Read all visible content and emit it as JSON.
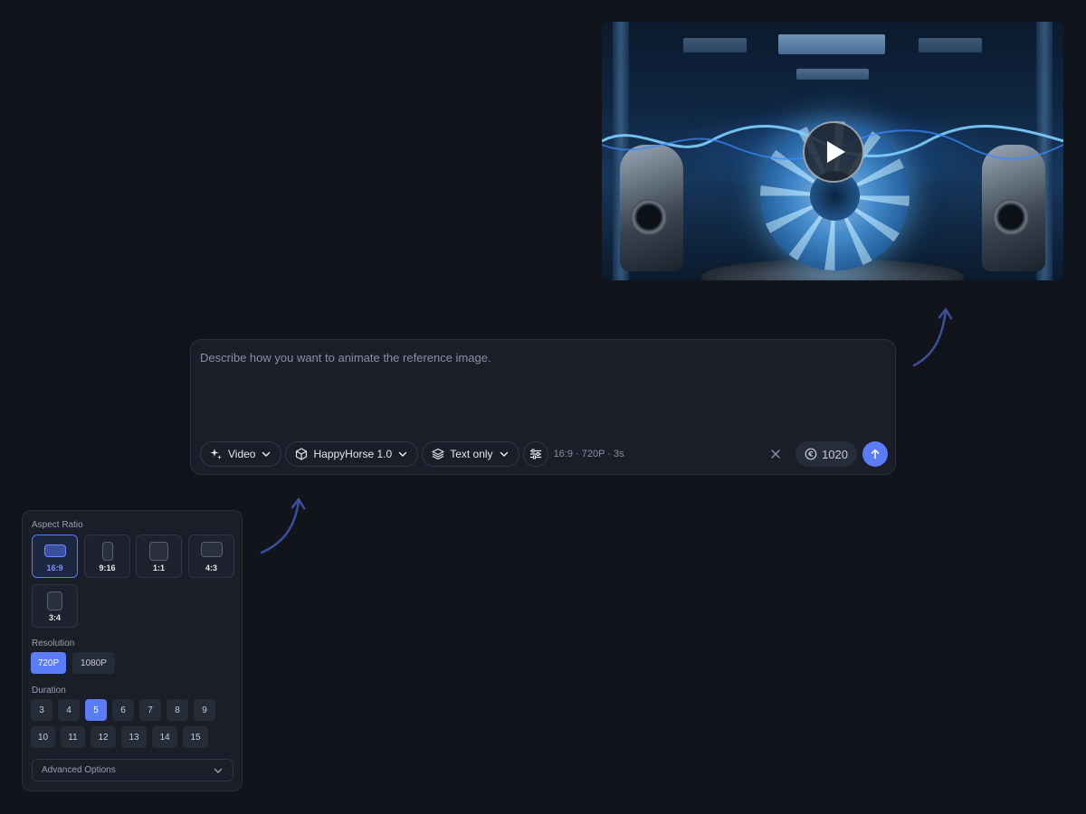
{
  "preview": {
    "play_icon": "play-icon"
  },
  "prompt": {
    "placeholder": "Describe how you want to animate the reference image.",
    "mode_label": "Video",
    "model_label": "HappyHorse 1.0",
    "input_label": "Text only",
    "settings_summary": "16:9 · 720P · 3s",
    "credits": "1020"
  },
  "panel": {
    "aspect_ratio_label": "Aspect Ratio",
    "aspect_ratios": [
      "16:9",
      "9:16",
      "1:1",
      "4:3",
      "3:4"
    ],
    "aspect_selected": "16:9",
    "resolution_label": "Resolution",
    "resolutions": [
      "720P",
      "1080P"
    ],
    "resolution_selected": "720P",
    "duration_label": "Duration",
    "durations": [
      "3",
      "4",
      "5",
      "6",
      "7",
      "8",
      "9",
      "10",
      "11",
      "12",
      "13",
      "14",
      "15"
    ],
    "duration_selected": "5",
    "advanced_label": "Advanced Options"
  },
  "colors": {
    "accent": "#5b7cf7",
    "background": "#12141c",
    "surface": "#1a1e29"
  }
}
